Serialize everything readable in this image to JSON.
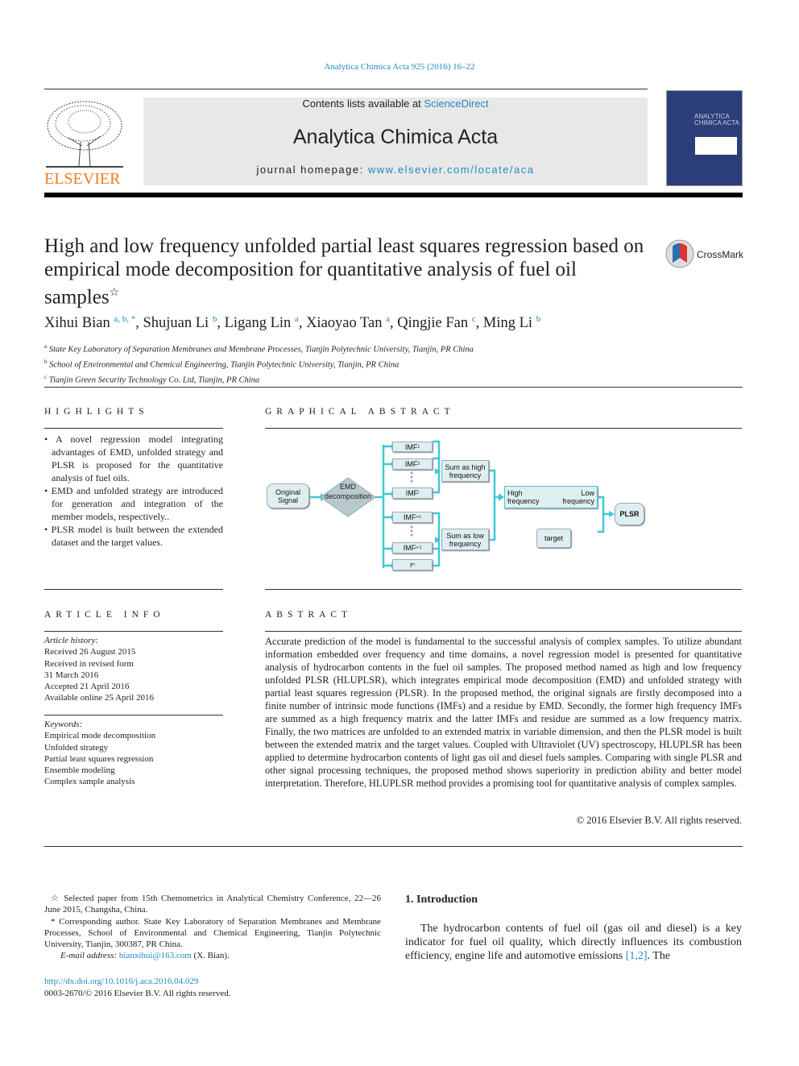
{
  "header": {
    "journal_ref": "Analytica Chimica Acta 925 (2016) 16–22",
    "contents_prefix": "Contents lists available at ",
    "sciencedirect": "ScienceDirect",
    "journal_name": "Analytica Chimica Acta",
    "homepage_prefix": "journal homepage: ",
    "homepage_url": "www.elsevier.com/locate/aca",
    "publisher": "ELSEVIER",
    "cover_title": "ANALYTICA CHIMICA ACTA"
  },
  "article": {
    "title": "High and low frequency unfolded partial least squares regression based on empirical mode decomposition for quantitative analysis of fuel oil samples",
    "title_mark": "☆",
    "crossmark": "CrossMark",
    "authors": [
      {
        "name": "Xihui Bian",
        "sup": "a, b, *"
      },
      {
        "name": "Shujuan Li",
        "sup": "b"
      },
      {
        "name": "Ligang Lin",
        "sup": "a"
      },
      {
        "name": "Xiaoyao Tan",
        "sup": "a"
      },
      {
        "name": "Qingjie Fan",
        "sup": "c"
      },
      {
        "name": "Ming Li",
        "sup": "b"
      }
    ],
    "affiliations": [
      {
        "sup": "a",
        "text": "State Key Laboratory of Separation Membranes and Membrane Processes, Tianjin Polytechnic University, Tianjin, PR China"
      },
      {
        "sup": "b",
        "text": "School of Environmental and Chemical Engineering, Tianjin Polytechnic University, Tianjin, PR China"
      },
      {
        "sup": "c",
        "text": "Tianjin Green Security Technology Co. Ltd, Tianjin, PR China"
      }
    ]
  },
  "highlights": {
    "heading": "Highlights",
    "items": [
      "A novel regression model integrating advantages of EMD, unfolded strategy and PLSR is proposed for the quantitative analysis of fuel oils.",
      "EMD and unfolded strategy are introduced for generation and integration of the member models, respectively..",
      "PLSR model is built between the extended dataset and the target values."
    ]
  },
  "graphical_abstract": {
    "heading": "Graphical abstract",
    "original": "Original Signal",
    "emd": "EMD decomposition",
    "imf": "IMF",
    "imf_subs": [
      "1",
      "2",
      "i",
      "i+1",
      "n-1"
    ],
    "r": "r",
    "r_sub": "n",
    "sum_high": "Sum as high frequency",
    "sum_low": "Sum as low frequency",
    "high": "High frequency",
    "low": "Low frequency",
    "target": "target",
    "plsr": "PLSR",
    "accent": "#3fc8d8"
  },
  "article_info": {
    "heading": "Article info",
    "history_label": "Article history:",
    "history": [
      "Received 26 August 2015",
      "Received in revised form",
      "31 March 2016",
      "Accepted 21 April 2016",
      "Available online 25 April 2016"
    ],
    "keywords_label": "Keywords:",
    "keywords": [
      "Empirical mode decomposition",
      "Unfolded strategy",
      "Partial least squares regression",
      "Ensemble modeling",
      "Complex sample analysis"
    ]
  },
  "abstract": {
    "heading": "Abstract",
    "text": "Accurate prediction of the model is fundamental to the successful analysis of complex samples. To utilize abundant information embedded over frequency and time domains, a novel regression model is presented for quantitative analysis of hydrocarbon contents in the fuel oil samples. The proposed method named as high and low frequency unfolded PLSR (HLUPLSR), which integrates empirical mode decomposition (EMD) and unfolded strategy with partial least squares regression (PLSR). In the proposed method, the original signals are firstly decomposed into a finite number of intrinsic mode functions (IMFs) and a residue by EMD. Secondly, the former high frequency IMFs are summed as a high frequency matrix and the latter IMFs and residue are summed as a low frequency matrix. Finally, the two matrices are unfolded to an extended matrix in variable dimension, and then the PLSR model is built between the extended matrix and the target values. Coupled with Ultraviolet (UV) spectroscopy, HLUPLSR has been applied to determine hydrocarbon contents of light gas oil and diesel fuels samples. Comparing with single PLSR and other signal processing techniques, the proposed method shows superiority in prediction ability and better model interpretation. Therefore, HLUPLSR method provides a promising tool for quantitative analysis of complex samples.",
    "copyright": "© 2016 Elsevier B.V. All rights reserved."
  },
  "footnotes": {
    "star": "☆ Selected paper from 15th Chemometrics in Analytical Chemistry Conference, 22—26 June 2015, Changsha, China.",
    "corresponding": "* Corresponding author. State Key Laboratory of Separation Membranes and Membrane Processes, School of Environmental and Chemical Engineering, Tianjin Polytechnic University, Tianjin, 300387, PR China.",
    "email_label": "E-mail address: ",
    "email": "bianxihui@163.com",
    "email_suffix": " (X. Bian).",
    "doi": "http://dx.doi.org/10.1016/j.aca.2016.04.029",
    "issn": "0003-2670/© 2016 Elsevier B.V. All rights reserved."
  },
  "introduction": {
    "heading": "1.  Introduction",
    "text": "The hydrocarbon contents of fuel oil (gas oil and diesel) is a key indicator for fuel oil quality, which directly influences its combustion efficiency, engine life and automotive emissions ",
    "cite": "[1,2]",
    "tail": ". The"
  }
}
